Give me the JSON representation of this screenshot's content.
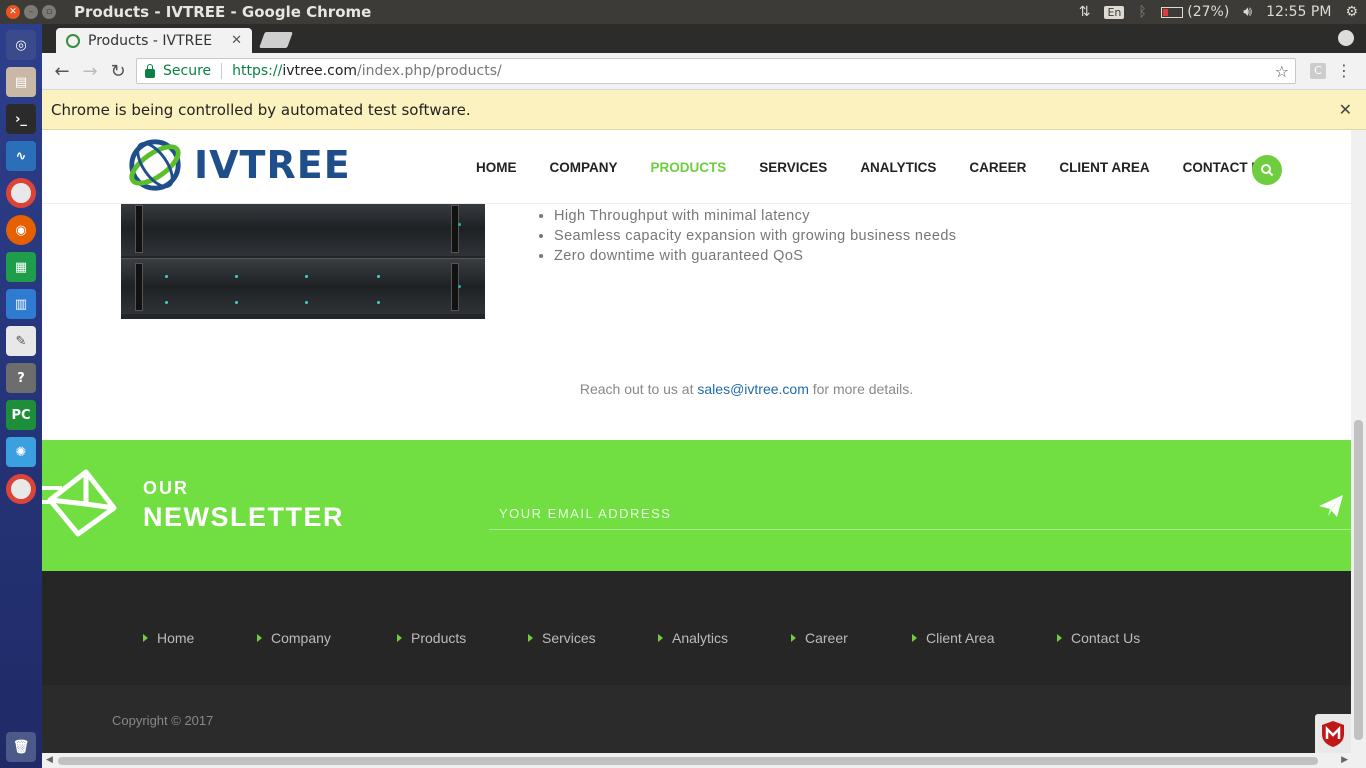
{
  "os": {
    "window_title": "Products - IVTREE - Google Chrome",
    "keyboard": "En",
    "battery": "(27%)",
    "clock": "12:55 PM"
  },
  "browser": {
    "tab_title": "Products - IVTREE",
    "secure_label": "Secure",
    "url_proto": "https://",
    "url_host": "ivtree.com",
    "url_path": "/index.php/products/",
    "infobar": "Chrome is being controlled by automated test software."
  },
  "site": {
    "logo_text": "IVTREE",
    "nav": [
      "HOME",
      "COMPANY",
      "PRODUCTS",
      "SERVICES",
      "ANALYTICS",
      "CAREER",
      "CLIENT AREA",
      "CONTACT US"
    ],
    "active_nav": "PRODUCTS",
    "features": [
      "High Throughput with minimal latency",
      "Seamless capacity expansion with growing business needs",
      "Zero downtime with guaranteed QoS"
    ],
    "contact": {
      "prefix": "Reach out to us at ",
      "email": "sales@ivtree.com",
      "suffix": " for more details."
    },
    "newsletter": {
      "line1": "OUR",
      "line2": "NEWSLETTER",
      "placeholder": "YOUR EMAIL ADDRESS"
    },
    "footer_links": [
      "Home",
      "Company",
      "Products",
      "Services",
      "Analytics",
      "Career",
      "Client Area",
      "Contact Us"
    ],
    "copyright": "Copyright © 2017"
  },
  "colors": {
    "accent_green": "#71df41",
    "brand_blue": "#1f4f8a",
    "footer_dark": "#262626"
  }
}
